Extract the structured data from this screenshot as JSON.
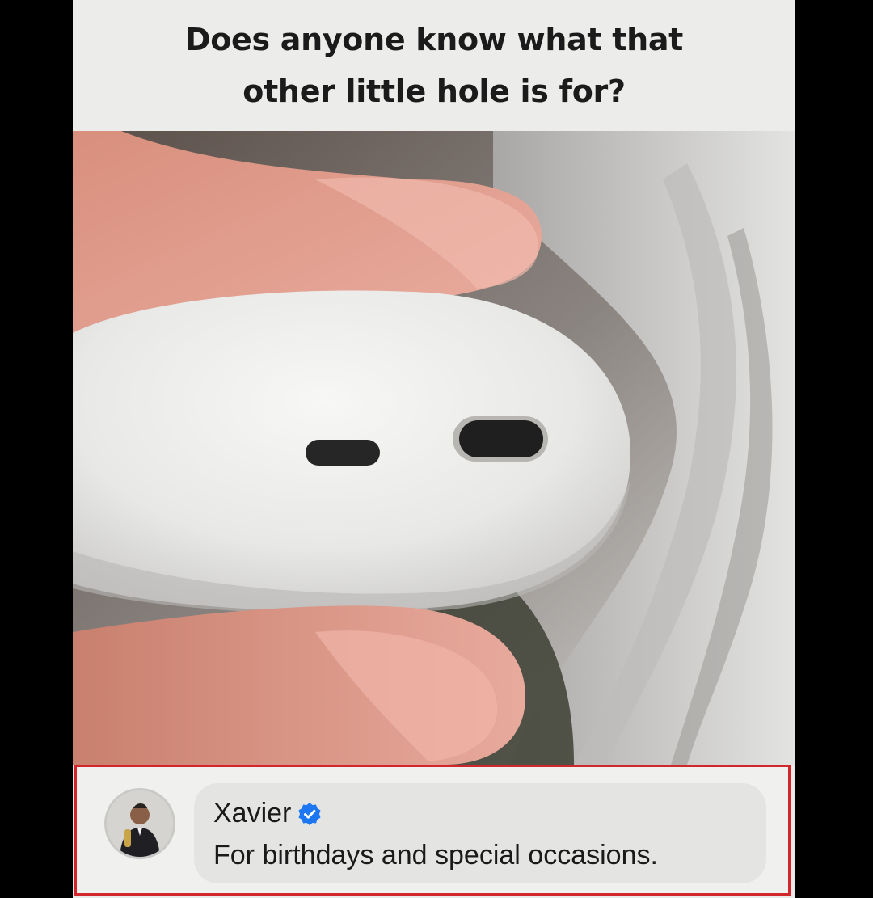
{
  "post": {
    "caption": "Does anyone know what that other little hole is for?"
  },
  "photo": {
    "subject_icon": "earbud-case-photo"
  },
  "comment": {
    "author": "Xavier",
    "verified_icon": "verified-badge-icon",
    "text": "For birthdays and special occasions.",
    "highlight_color": "#d0262c"
  }
}
